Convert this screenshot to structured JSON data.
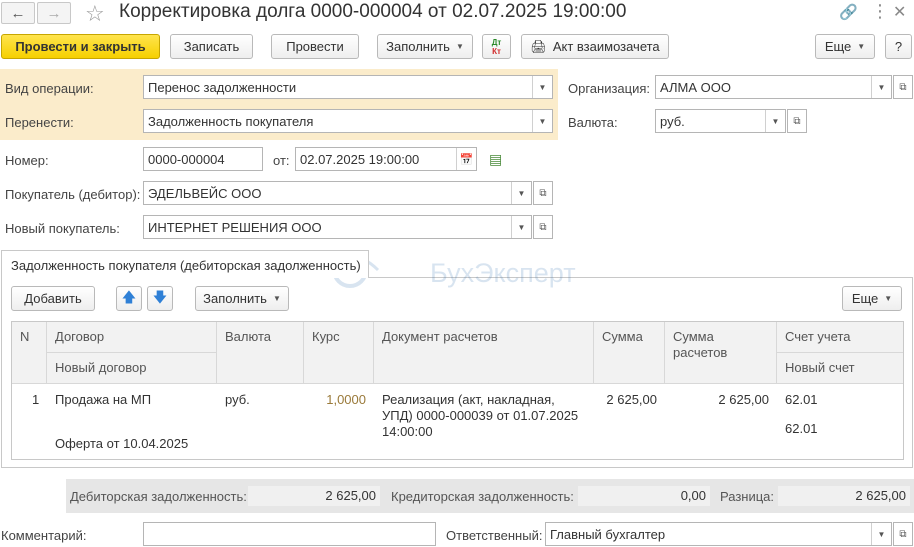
{
  "window": {
    "title": "Корректировка долга 0000-000004 от 02.07.2025 19:00:00"
  },
  "toolbar": {
    "post_close": "Провести и закрыть",
    "save": "Записать",
    "post": "Провести",
    "fill": "Заполнить",
    "act": "Акт взаимозачета",
    "more": "Еще",
    "help": "?",
    "dt_kt_top": "Дт",
    "dt_kt_bottom": "Кт"
  },
  "form": {
    "operation_label": "Вид операции:",
    "operation_value": "Перенос задолженности",
    "transfer_label": "Перенести:",
    "transfer_value": "Задолженность покупателя",
    "org_label": "Организация:",
    "org_value": "АЛМА ООО",
    "currency_label": "Валюта:",
    "currency_value": "руб.",
    "number_label": "Номер:",
    "number_value": "0000-000004",
    "date_label": "от:",
    "date_value": "02.07.2025 19:00:00",
    "buyer_label": "Покупатель (дебитор):",
    "buyer_value": "ЭДЕЛЬВЕЙС ООО",
    "new_buyer_label": "Новый покупатель:",
    "new_buyer_value": "ИНТЕРНЕТ РЕШЕНИЯ ООО"
  },
  "tab": {
    "label": "Задолженность покупателя (дебиторская задолженность)"
  },
  "watermark": {
    "text": "БухЭксперт"
  },
  "table_toolbar": {
    "add": "Добавить",
    "fill": "Заполнить",
    "more": "Еще"
  },
  "table": {
    "headers": {
      "n": "N",
      "contract": "Договор",
      "new_contract": "Новый договор",
      "currency": "Валюта",
      "rate": "Курс",
      "doc": "Документ расчетов",
      "sum": "Сумма",
      "calc_sum": "Сумма расчетов",
      "account": "Счет учета",
      "new_account": "Новый счет"
    },
    "rows": [
      {
        "n": "1",
        "contract": "Продажа на МП",
        "new_contract": "Оферта от 10.04.2025",
        "currency": "руб.",
        "rate": "1,0000",
        "doc": "Реализация (акт, накладная, УПД) 0000-000039 от 01.07.2025 14:00:00",
        "sum": "2 625,00",
        "calc_sum": "2 625,00",
        "account": "62.01",
        "new_account": "62.01"
      }
    ]
  },
  "totals": {
    "debt_label": "Дебиторская задолженность:",
    "debt_value": "2 625,00",
    "credit_label": "Кредиторская задолженность:",
    "credit_value": "0,00",
    "diff_label": "Разница:",
    "diff_value": "2 625,00"
  },
  "footer": {
    "comment_label": "Комментарий:",
    "comment_value": "",
    "responsible_label": "Ответственный:",
    "responsible_value": "Главный бухгалтер"
  },
  "colors": {
    "accent_yellow": "#f6d000",
    "form_highlight": "#fbeccb",
    "arrow_blue": "#2f80d6",
    "rate_text": "#9a7a3a"
  }
}
